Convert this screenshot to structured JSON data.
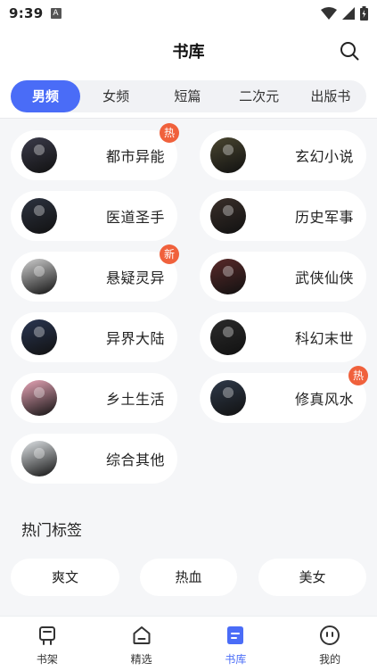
{
  "status_bar": {
    "time": "9:39",
    "notif_icon": "A"
  },
  "header": {
    "title": "书库"
  },
  "tabs": [
    {
      "label": "男频",
      "active": true
    },
    {
      "label": "女频"
    },
    {
      "label": "短篇"
    },
    {
      "label": "二次元"
    },
    {
      "label": "出版书"
    }
  ],
  "categories": [
    {
      "label": "都市异能",
      "badge": "热",
      "cover_color": "#3b3b4a"
    },
    {
      "label": "玄幻小说",
      "cover_color": "#4a4630"
    },
    {
      "label": "医道圣手",
      "cover_color": "#2d3340"
    },
    {
      "label": "历史军事",
      "cover_color": "#3a2f2a"
    },
    {
      "label": "悬疑灵异",
      "badge": "新",
      "cover_color": "#cfcfcf"
    },
    {
      "label": "武侠仙侠",
      "cover_color": "#5a2a2a"
    },
    {
      "label": "异界大陆",
      "cover_color": "#2a3652"
    },
    {
      "label": "科幻末世",
      "cover_color": "#2b2b2b"
    },
    {
      "label": "乡土生活",
      "cover_color": "#e8a6b8"
    },
    {
      "label": "修真风水",
      "badge": "热",
      "cover_color": "#2f3a4a"
    },
    {
      "label": "综合其他",
      "cover_color": "#dfe3e6"
    }
  ],
  "hot_tags": {
    "title": "热门标签",
    "items": [
      "爽文",
      "热血",
      "美女"
    ]
  },
  "bottom_nav": [
    {
      "label": "书架",
      "icon": "bookshelf-icon"
    },
    {
      "label": "精选",
      "icon": "home-icon"
    },
    {
      "label": "书库",
      "icon": "library-icon",
      "active": true
    },
    {
      "label": "我的",
      "icon": "profile-icon"
    }
  ],
  "colors": {
    "accent": "#4a6cf7",
    "badge": "#f0613c",
    "background": "#f5f6f8"
  }
}
